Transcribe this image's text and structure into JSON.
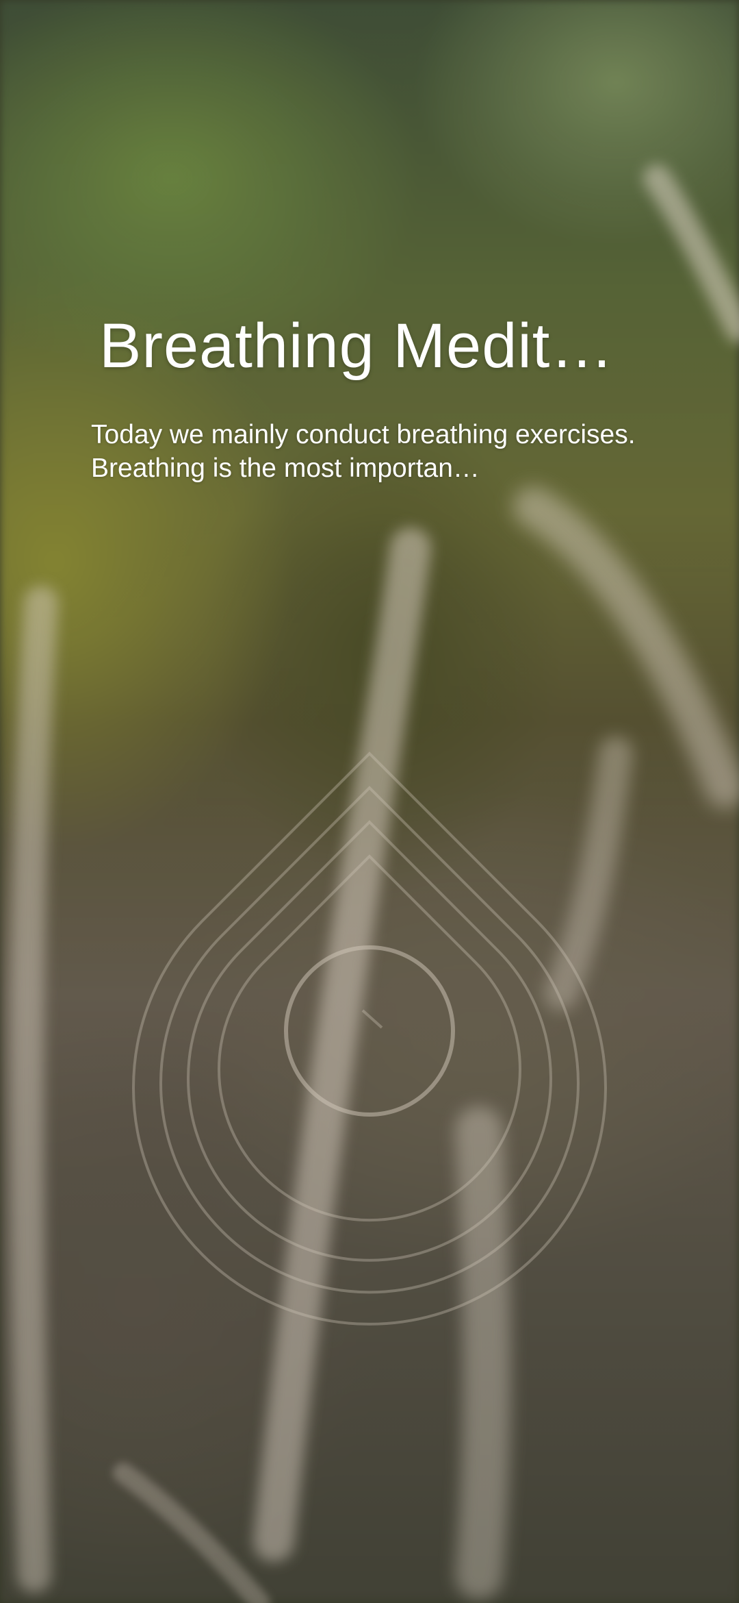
{
  "meditation": {
    "title": "Breathing Medita…",
    "description": "Today we mainly conduct breathing exercises. Breathing is the most importan…"
  },
  "graphic": {
    "icon": "breathing-drop-rings-icon"
  },
  "colors": {
    "text": "#ffffff",
    "ring_stroke": "#c8bfae"
  }
}
